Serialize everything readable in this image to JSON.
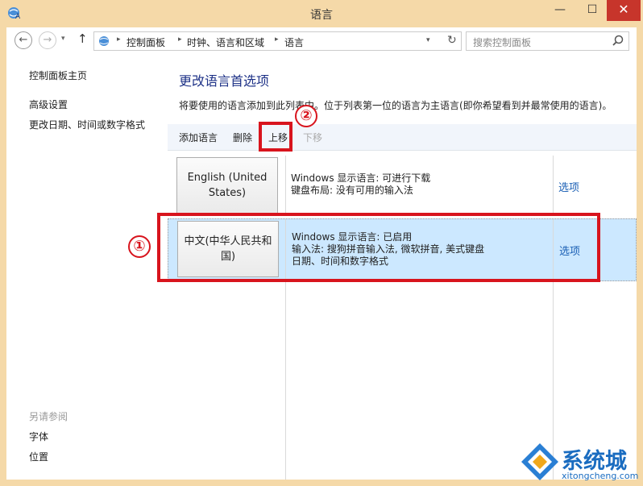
{
  "window": {
    "title": "语言",
    "min_glyph": "—",
    "max_glyph": "☐",
    "close_glyph": "✕"
  },
  "nav": {
    "back_glyph": "←",
    "forward_glyph": "→",
    "dropdown_glyph": "▾",
    "up_glyph": "↑",
    "breadcrumb": [
      "控制面板",
      "时钟、语言和区域",
      "语言"
    ],
    "separator": "▸",
    "refresh_glyph": "↻",
    "search_placeholder": "搜索控制面板"
  },
  "sidebar": {
    "home_link": "控制面板主页",
    "links": [
      "高级设置",
      "更改日期、时间或数字格式"
    ],
    "see_also_heading": "另请参阅",
    "see_also_links": [
      "字体",
      "位置"
    ]
  },
  "main": {
    "title": "更改语言首选项",
    "description": "将要使用的语言添加到此列表中。位于列表第一位的语言为主语言(即你希望看到并最常使用的语言)。",
    "toolbar": {
      "add": "添加语言",
      "remove": "删除",
      "move_up": "上移",
      "move_down": "下移"
    },
    "languages": [
      {
        "name": "English (United States)",
        "info": [
          "Windows 显示语言: 可进行下载",
          "键盘布局: 没有可用的输入法"
        ],
        "options": "选项"
      },
      {
        "name": "中文(中华人民共和国)",
        "info": [
          "Windows 显示语言: 已启用",
          "输入法: 搜狗拼音输入法, 微软拼音, 美式键盘",
          "日期、时间和数字格式"
        ],
        "options": "选项"
      }
    ]
  },
  "annotations": {
    "one": "①",
    "two": "②",
    "color": "#d8141d"
  },
  "watermark": {
    "name": "系统城",
    "url": "xitongcheng.com"
  },
  "colors": {
    "title_bar": "#f5d9a8",
    "selected_row": "#cce8ff",
    "link": "#1a5fb4",
    "heading": "#1e3287"
  }
}
